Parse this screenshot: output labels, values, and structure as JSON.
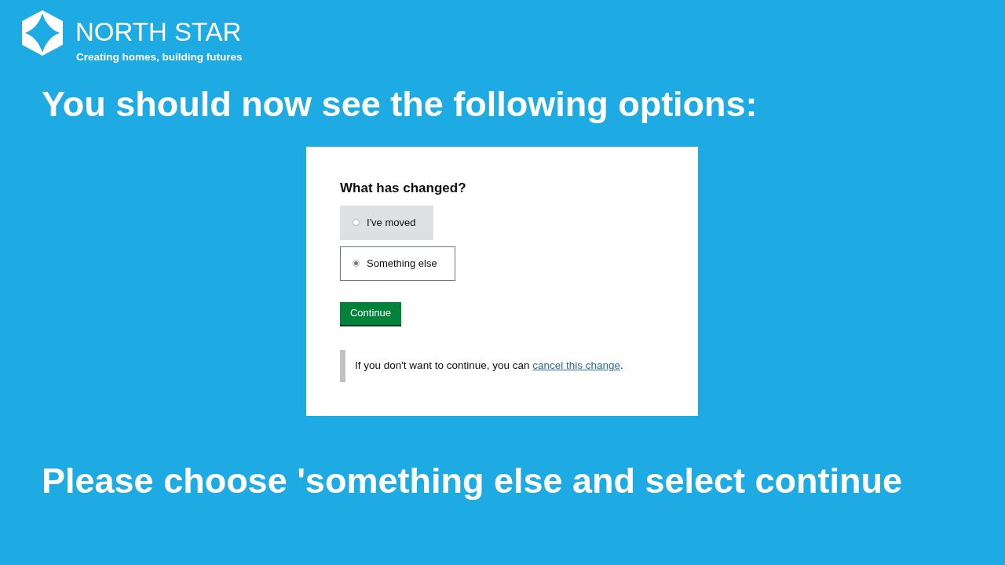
{
  "brand": {
    "name": "NORTH STAR",
    "tagline": "Creating homes, building futures"
  },
  "heading": "You should now see the following options:",
  "form": {
    "question": "What has changed?",
    "options": [
      {
        "label": "I've moved",
        "selected": false
      },
      {
        "label": "Something else",
        "selected": true
      }
    ],
    "button": "Continue",
    "notice": {
      "text": "If you don't want to continue, you can ",
      "link": "cancel this change",
      "after": "."
    }
  },
  "instruction": "Please choose 'something else and select continue"
}
